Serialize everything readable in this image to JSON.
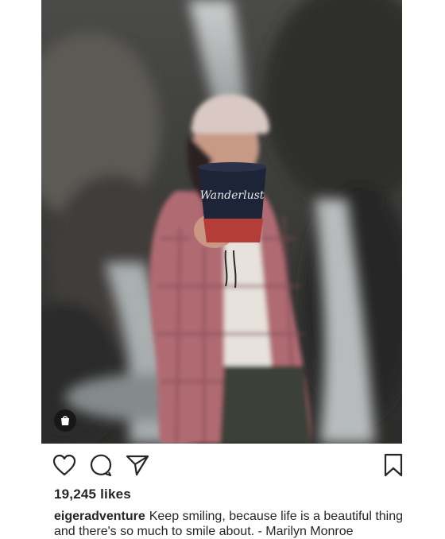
{
  "post": {
    "image_alt": "post-photo",
    "likes_text": "19,245 likes",
    "caption": {
      "username": "eigeradventure",
      "text": "Keep smiling, because life is a beautiful thing and there's so much to smile about. - Marilyn Monroe"
    },
    "cup_label": "Wanderlust"
  },
  "actions": {
    "like_icon": "heart-icon",
    "comment_icon": "comment-icon",
    "share_icon": "paper-plane-icon",
    "save_icon": "bookmark-icon",
    "shop_icon": "shopping-bag-icon"
  }
}
